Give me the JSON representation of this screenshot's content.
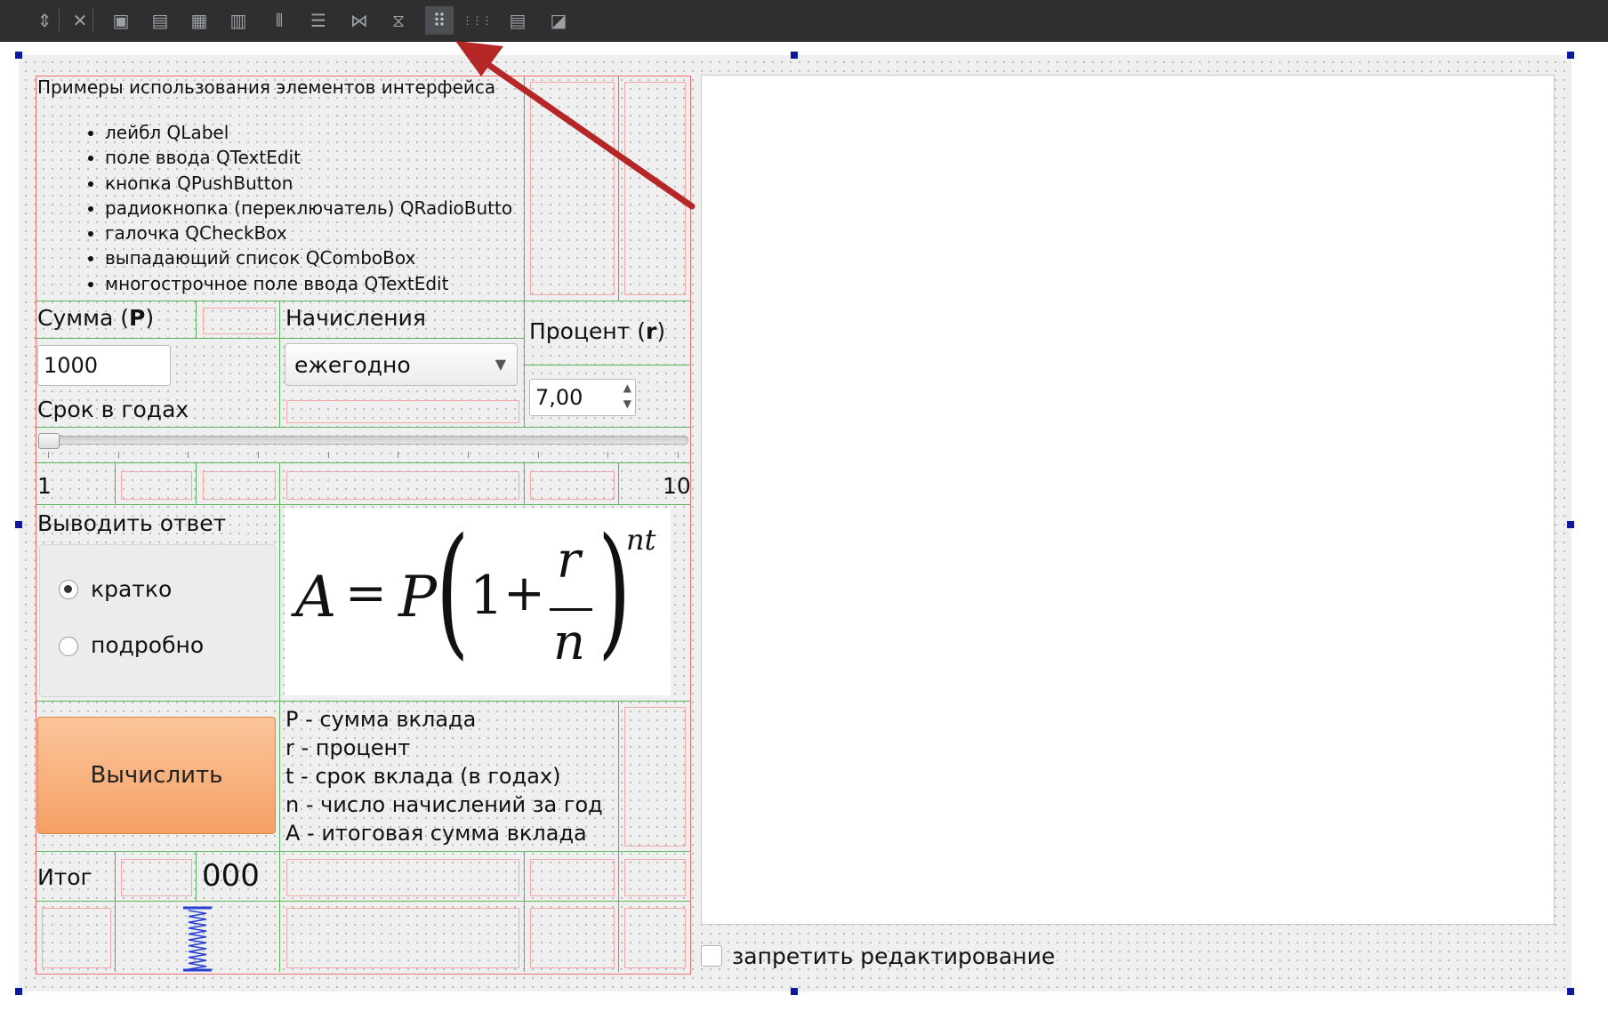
{
  "toolbar": {
    "icons": [
      "sort-updown-icon",
      "close-x-icon",
      "edit-widgets-icon",
      "edit-signals-icon",
      "edit-buddies-icon",
      "edit-tab-order-icon",
      "layout-horizontal-icon",
      "layout-vertical-icon",
      "splitter-horizontal-icon",
      "splitter-vertical-icon",
      "layout-form-icon",
      "layout-grid-icon",
      "break-layout-icon",
      "adjust-size-icon"
    ],
    "glyphs": [
      "⇕",
      "✕",
      "▣",
      "▤",
      "▦",
      "▥",
      "⦀",
      "☰",
      "⋈",
      "⧖",
      "⠿",
      "⋮⋮⋮",
      "▤",
      "◪"
    ]
  },
  "intro": {
    "title": "Примеры использования элементов интерфейса",
    "items": [
      "лейбл QLabel",
      "поле ввода QTextEdit",
      "кнопка QPushButton",
      "радиокнопка (переключатель) QRadioButton",
      "галочка QCheckBox",
      "выпадающий список QComboBox",
      "многострочное поле ввода QTextEdit"
    ]
  },
  "sum": {
    "label_prefix": "Сумма (",
    "label_var": "P",
    "label_suffix": ")",
    "value": "1000"
  },
  "accrual": {
    "label": "Начисления",
    "selected": "ежегодно"
  },
  "percent": {
    "label_prefix": "Процент (",
    "label_var": "r",
    "label_suffix": ")",
    "value": "7,00"
  },
  "term": {
    "label": "Срок в годах",
    "min_label": "1",
    "max_label": "10",
    "value": 1,
    "min": 1,
    "max": 10
  },
  "output": {
    "label": "Выводить ответ",
    "options": [
      "кратко",
      "подробно"
    ],
    "selected_index": 0
  },
  "formula": {
    "A": "A",
    "eq": "=",
    "P": "P",
    "one": "1",
    "plus": "+",
    "r": "r",
    "n": "n",
    "exp": "nt"
  },
  "legend": [
    "P - сумма вклада",
    "r - процент",
    "t - срок вклада (в годах)",
    "n - число начислений за год",
    "A - итоговая сумма вклада"
  ],
  "compute_button": {
    "label": "Вычислить"
  },
  "result": {
    "label": "Итог",
    "value": "000"
  },
  "editor": {
    "lock_label": "запретить редактирование",
    "lock_checked": false
  },
  "colors": {
    "accent_arrow": "#b52626",
    "button": "#f5a065",
    "selection_handle": "#0b1a9a"
  }
}
